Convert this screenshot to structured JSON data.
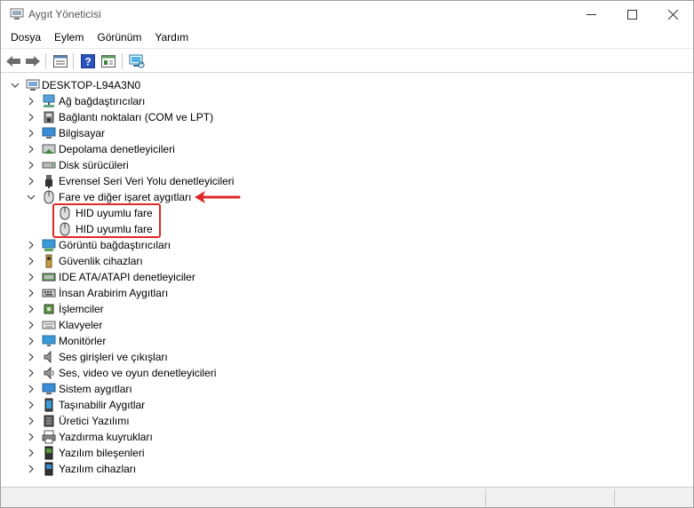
{
  "window": {
    "title": "Aygıt Yöneticisi",
    "controls": {
      "minimize": "–",
      "maximize": "☐",
      "close": "✕"
    }
  },
  "menu": [
    "Dosya",
    "Eylem",
    "Görünüm",
    "Yardım"
  ],
  "toolbar": [
    "back-icon",
    "forward-icon",
    "properties-icon",
    "help-icon",
    "update-driver-icon",
    "scan-hardware-icon"
  ],
  "tree": {
    "root": "DESKTOP-L94A3N0",
    "categories": [
      {
        "label": "Ağ bağdaştırıcıları",
        "icon": "network-adapter-icon",
        "expanded": false
      },
      {
        "label": "Bağlantı noktaları (COM ve LPT)",
        "icon": "port-icon",
        "expanded": false
      },
      {
        "label": "Bilgisayar",
        "icon": "computer-icon",
        "expanded": false
      },
      {
        "label": "Depolama denetleyicileri",
        "icon": "storage-controller-icon",
        "expanded": false
      },
      {
        "label": "Disk sürücüleri",
        "icon": "disk-drive-icon",
        "expanded": false
      },
      {
        "label": "Evrensel Seri Veri Yolu denetleyicileri",
        "icon": "usb-icon",
        "expanded": false
      },
      {
        "label": "Fare ve diğer işaret aygıtları",
        "icon": "mouse-icon",
        "expanded": true,
        "children": [
          "HID uyumlu fare",
          "HID uyumlu fare"
        ]
      },
      {
        "label": "Görüntü bağdaştırıcıları",
        "icon": "display-adapter-icon",
        "expanded": false
      },
      {
        "label": "Güvenlik cihazları",
        "icon": "security-device-icon",
        "expanded": false
      },
      {
        "label": "IDE ATA/ATAPI denetleyiciler",
        "icon": "ide-controller-icon",
        "expanded": false
      },
      {
        "label": "İnsan Arabirim Aygıtları",
        "icon": "hid-icon",
        "expanded": false
      },
      {
        "label": "İşlemciler",
        "icon": "processor-icon",
        "expanded": false
      },
      {
        "label": "Klavyeler",
        "icon": "keyboard-icon",
        "expanded": false
      },
      {
        "label": "Monitörler",
        "icon": "monitor-icon",
        "expanded": false
      },
      {
        "label": "Ses girişleri ve çıkışları",
        "icon": "audio-io-icon",
        "expanded": false
      },
      {
        "label": "Ses, video ve oyun denetleyicileri",
        "icon": "sound-controller-icon",
        "expanded": false
      },
      {
        "label": "Sistem aygıtları",
        "icon": "system-device-icon",
        "expanded": false
      },
      {
        "label": "Taşınabilir Aygıtlar",
        "icon": "portable-device-icon",
        "expanded": false
      },
      {
        "label": "Üretici Yazılımı",
        "icon": "firmware-icon",
        "expanded": false
      },
      {
        "label": "Yazdırma kuyrukları",
        "icon": "print-queue-icon",
        "expanded": false
      },
      {
        "label": "Yazılım bileşenleri",
        "icon": "software-component-icon",
        "expanded": false
      },
      {
        "label": "Yazılım cihazları",
        "icon": "software-device-icon",
        "expanded": false
      }
    ]
  },
  "colors": {
    "annotation": "#e02828",
    "selection": "#cce8ff"
  }
}
